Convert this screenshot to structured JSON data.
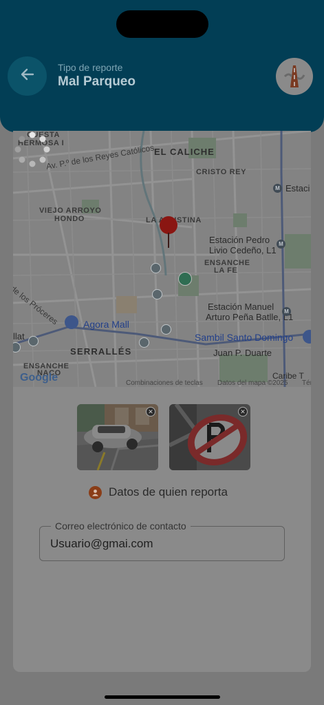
{
  "header": {
    "back_icon": "arrow-left-icon",
    "subtitle": "Tipo de reporte",
    "title": "Mal Parqueo",
    "logo_icon": "road-logo-icon"
  },
  "map": {
    "labels": {
      "cuesta": "CUESTA",
      "hermosa": "HERMOSA I",
      "el_caliche": "EL CALICHE",
      "reyes": "Av. P.º de los Reyes Católicos",
      "cristo_rey": "CRISTO REY",
      "estaci": "Estaci",
      "viejo_arroyo": "VIEJO ARROYO",
      "hondo": "HONDO",
      "la_agustina": "LA AGUSTINA",
      "estacion_pedro": "Estación Pedro",
      "livio": "Livio Cedeño, L1",
      "ensanche_la_fe_1": "ENSANCHE",
      "ensanche_la_fe_2": "LA FE",
      "de_los_proceres": "de los Próceres",
      "estacion_manuel": "Estación Manuel",
      "arturo": "Arturo Peña Batlle, L1",
      "agora_mall": "Agora Mall",
      "llat": "llat",
      "serralles": "SERRALLÉS",
      "sambil": "Sambil Santo Domingo",
      "juan_duarte": "Juan P. Duarte",
      "ensanche_2": "ENSANCHE",
      "naco": "NACO",
      "caribe": "Caribe T",
      "google": "Google",
      "shortcuts": "Combinaciones de teclas",
      "map_data": "Datos del mapa ©2025",
      "terms": "Tér"
    },
    "pin_color": "#8a1612",
    "loading": true
  },
  "photos": [
    {
      "alt": "photo-parked-car",
      "remove_icon": "close-icon"
    },
    {
      "alt": "photo-no-parking-sign",
      "remove_icon": "close-icon"
    }
  ],
  "reporter": {
    "icon": "person-icon",
    "label": "Datos de quien reporta"
  },
  "email_field": {
    "label": "Correo electrónico de contacto",
    "value": "Usuario@gmai.com"
  },
  "colors": {
    "header_bg": "#023e55",
    "accent": "#8a3d17"
  }
}
